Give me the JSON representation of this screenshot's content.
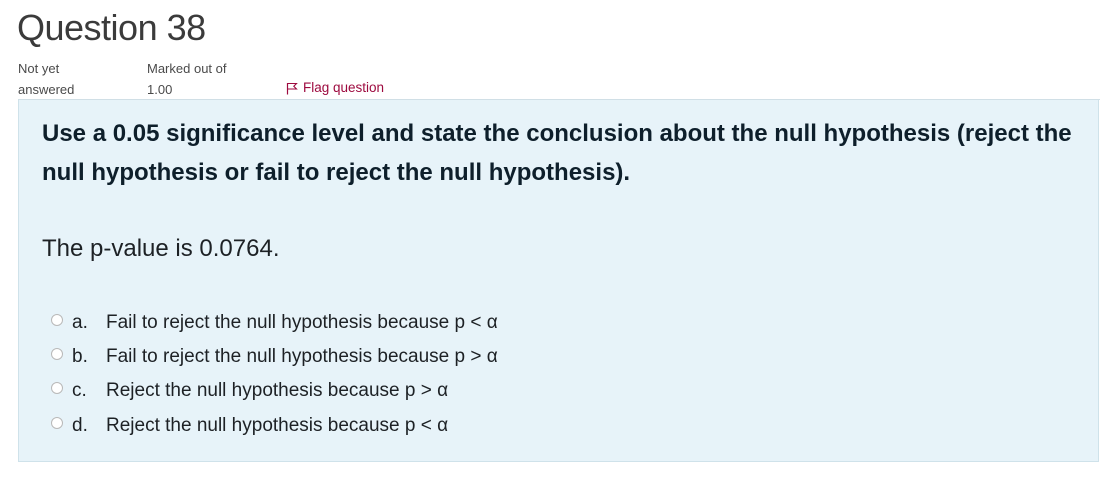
{
  "question": {
    "title": "Question 38",
    "status": {
      "line1": "Not yet",
      "line2": "answered"
    },
    "marks": {
      "line1": "Marked out of",
      "line2": "1.00"
    },
    "flag_label": "Flag question",
    "text": "Use a 0.05 significance level and state the conclusion about the null hypothesis (reject the null hypothesis or fail to reject the null hypothesis).",
    "pvalue_text": "The p-value is 0.0764.",
    "options": [
      {
        "letter": "a.",
        "text": "Fail to reject the null hypothesis because p < α",
        "selected": false
      },
      {
        "letter": "b.",
        "text": "Fail to reject the null hypothesis because p > α",
        "selected": false
      },
      {
        "letter": "c.",
        "text": "Reject the null hypothesis because p > α",
        "selected": false
      },
      {
        "letter": "d.",
        "text": "Reject the null hypothesis because p < α",
        "selected": false
      }
    ]
  },
  "colors": {
    "flag": "#9d0a3f",
    "box_background": "#e7f3f9",
    "question_text": "#0e1f2b"
  }
}
